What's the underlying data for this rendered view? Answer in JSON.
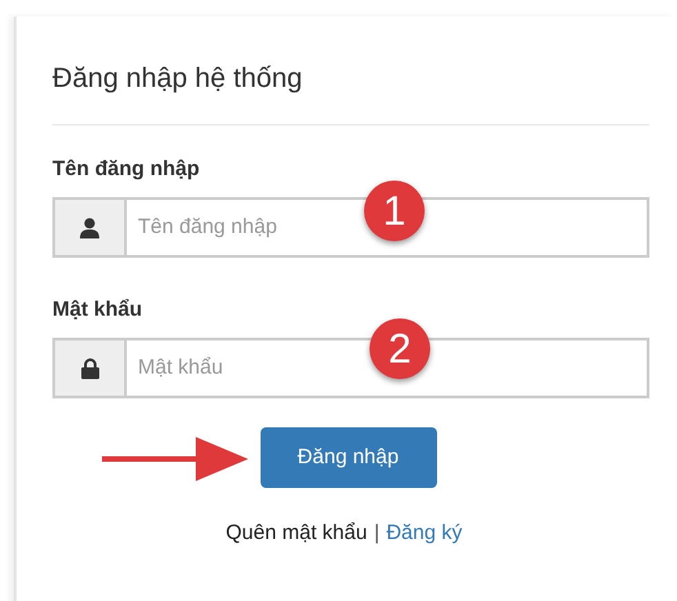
{
  "panel": {
    "title": "Đăng nhập hệ thống"
  },
  "fields": [
    {
      "label": "Tên đăng nhập",
      "placeholder": "Tên đăng nhập",
      "kind": "user",
      "callout": "1"
    },
    {
      "label": "Mật khẩu",
      "placeholder": "Mật khẩu",
      "kind": "password",
      "callout": "2"
    }
  ],
  "submit_button": "Đăng nhập",
  "footer": {
    "forgot_password": "Quên mật khẩu",
    "separator": "|",
    "register": "Đăng ký"
  }
}
